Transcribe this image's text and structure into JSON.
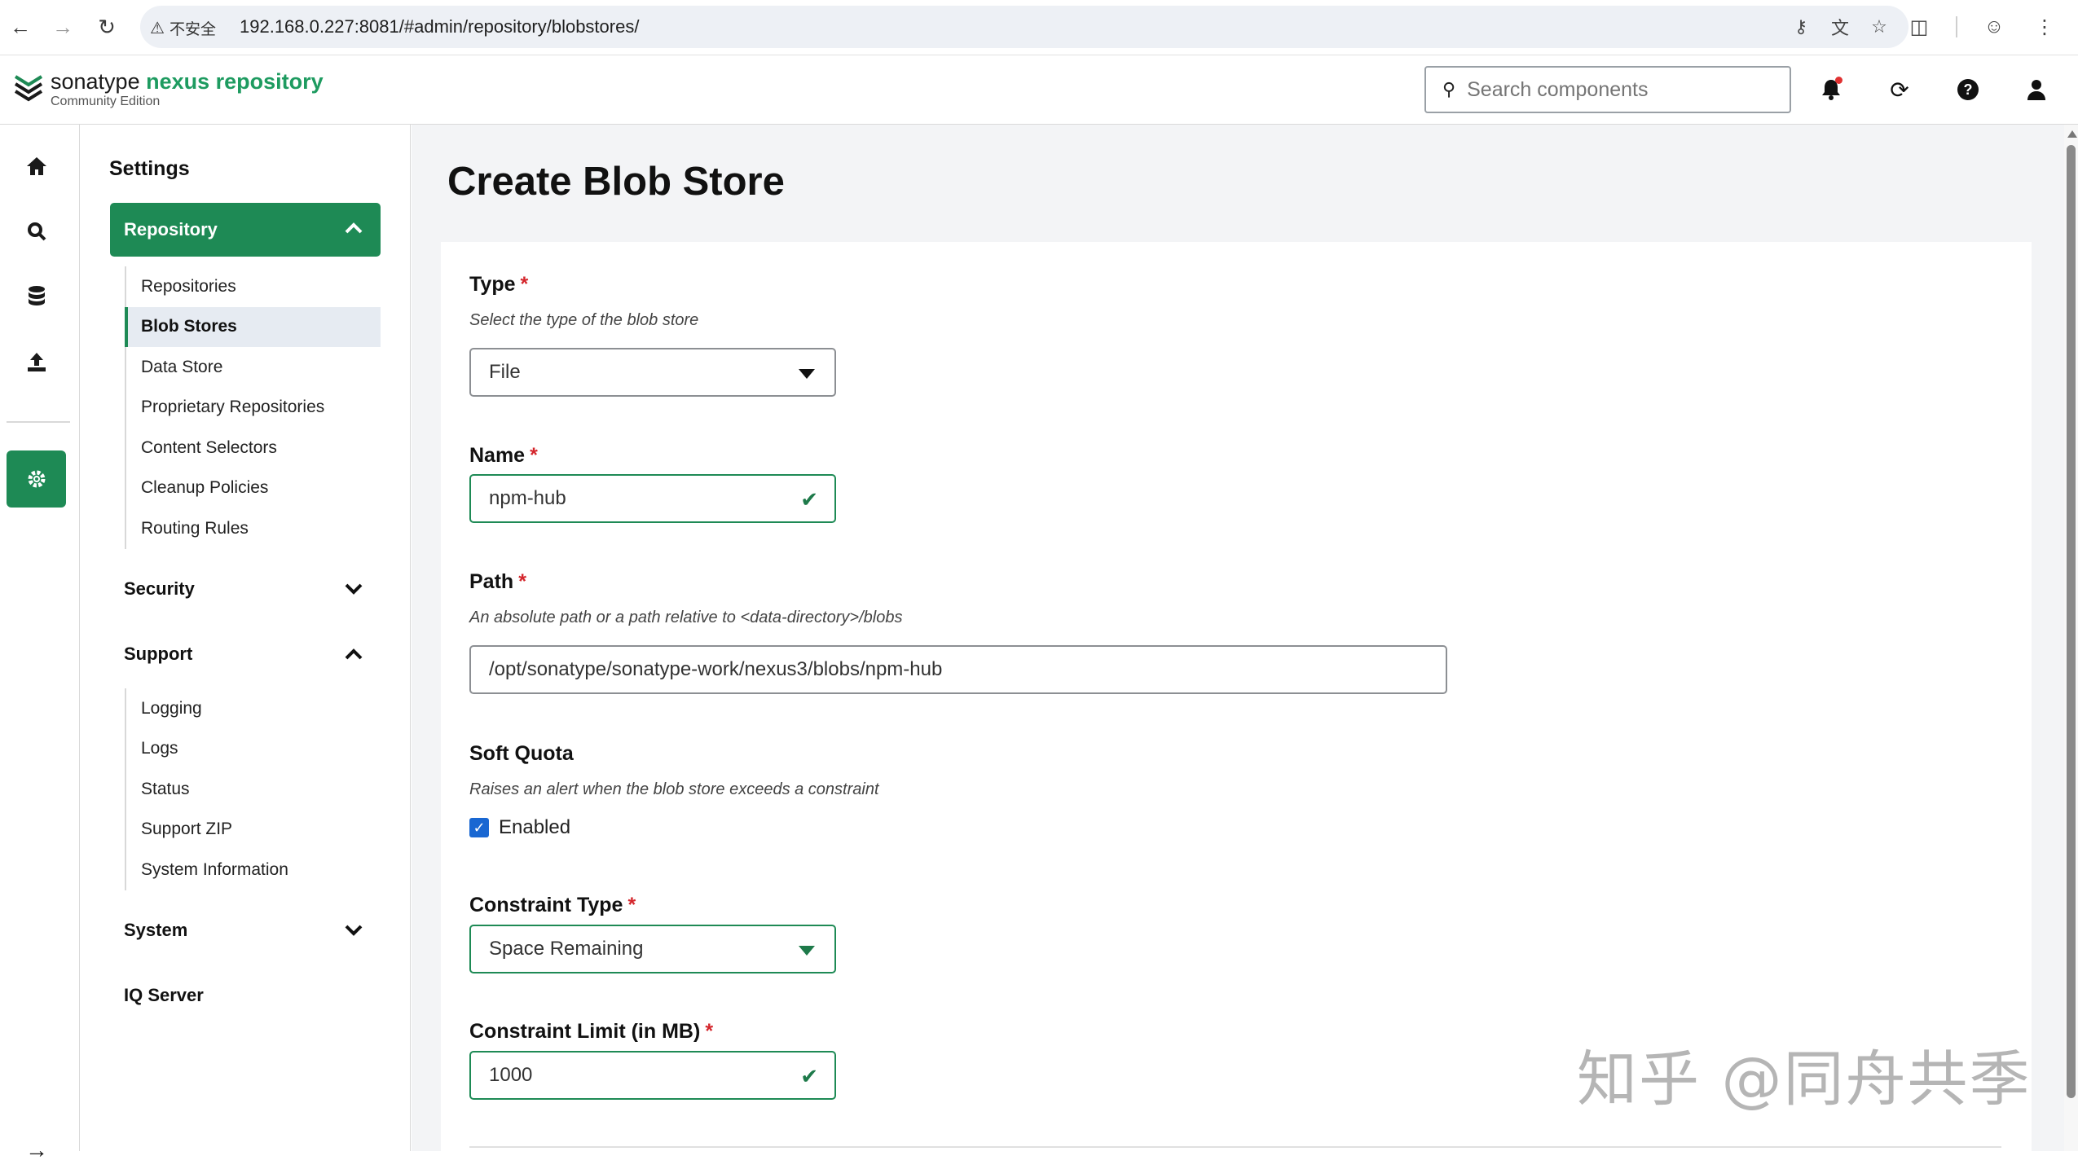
{
  "browser": {
    "security_label": "不安全",
    "url": "192.168.0.227:8081/#admin/repository/blobstores/"
  },
  "header": {
    "brand_part1": "sonatype ",
    "brand_part2": "nexus repository",
    "edition": "Community Edition",
    "search_placeholder": "Search components"
  },
  "sidebar": {
    "title": "Settings",
    "repository_label": "Repository",
    "repository_items": [
      "Repositories",
      "Blob Stores",
      "Data Store",
      "Proprietary Repositories",
      "Content Selectors",
      "Cleanup Policies",
      "Routing Rules"
    ],
    "active_item": "Blob Stores",
    "security_label": "Security",
    "support_label": "Support",
    "support_items": [
      "Logging",
      "Logs",
      "Status",
      "Support ZIP",
      "System Information"
    ],
    "system_label": "System",
    "iq_label": "IQ Server"
  },
  "form": {
    "page_title": "Create Blob Store",
    "type_label": "Type",
    "type_desc": "Select the type of the blob store",
    "type_value": "File",
    "name_label": "Name",
    "name_value": "npm-hub",
    "path_label": "Path",
    "path_desc": "An absolute path or a path relative to <data-directory>/blobs",
    "path_value": "/opt/sonatype/sonatype-work/nexus3/blobs/npm-hub",
    "soft_quota_label": "Soft Quota",
    "soft_quota_desc": "Raises an alert when the blob store exceeds a constraint",
    "enabled_label": "Enabled",
    "enabled_checked": true,
    "constraint_type_label": "Constraint Type",
    "constraint_type_value": "Space Remaining",
    "constraint_limit_label": "Constraint Limit (in MB)",
    "constraint_limit_value": "1000",
    "required_mark": "*"
  },
  "watermark": "知乎 @同舟共季",
  "colors": {
    "brand_green": "#1e8a55",
    "required_red": "#d4262c",
    "checkbox_blue": "#1967d2"
  }
}
